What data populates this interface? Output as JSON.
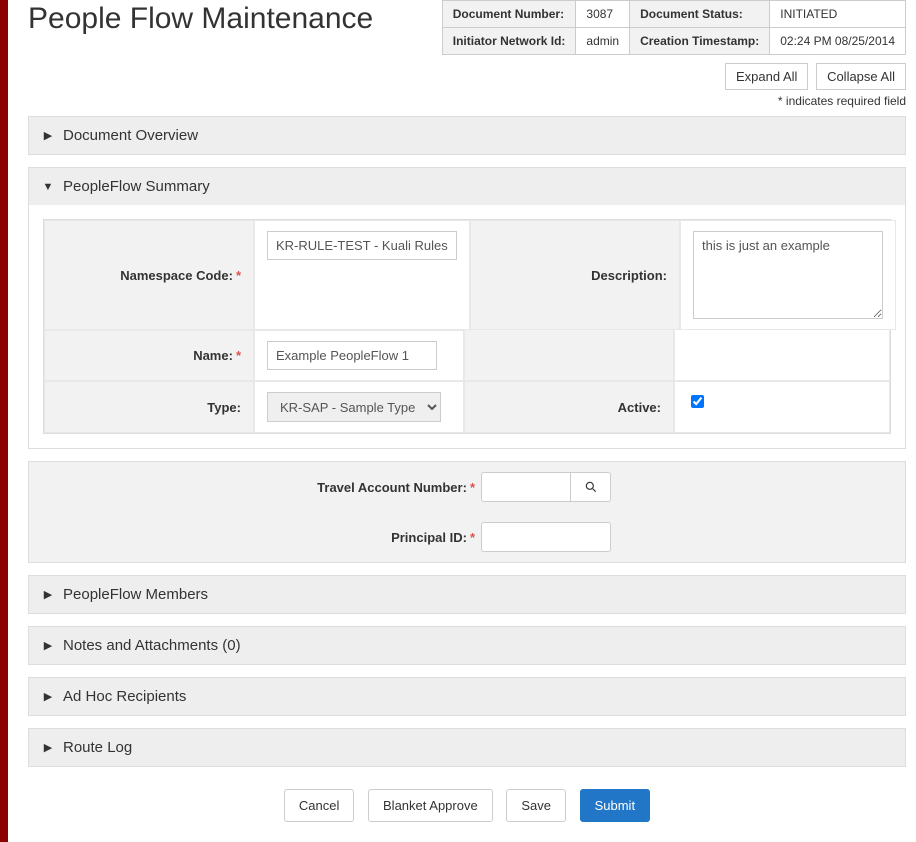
{
  "page_title": "People Flow Maintenance",
  "doc_info": {
    "number_label": "Document Number:",
    "number_value": "3087",
    "status_label": "Document Status:",
    "status_value": "INITIATED",
    "initiator_label": "Initiator Network Id:",
    "initiator_value": "admin",
    "created_label": "Creation Timestamp:",
    "created_value": "02:24 PM 08/25/2014"
  },
  "toolbar": {
    "expand_all": "Expand All",
    "collapse_all": "Collapse All"
  },
  "required_note": "* indicates required field",
  "sections": {
    "doc_overview": "Document Overview",
    "summary": "PeopleFlow Summary",
    "members": "PeopleFlow Members",
    "notes": "Notes and Attachments (0)",
    "adhoc": "Ad Hoc Recipients",
    "routelog": "Route Log"
  },
  "summary_form": {
    "namespace_label": "Namespace Code:",
    "namespace_value": "KR-RULE-TEST - Kuali Rules Test",
    "description_label": "Description:",
    "description_value": "this is just an example",
    "name_label": "Name:",
    "name_value": "Example PeopleFlow 1",
    "type_label": "Type:",
    "type_value": "KR-SAP - Sample Type",
    "active_label": "Active:"
  },
  "account_form": {
    "travel_label": "Travel Account Number:",
    "principal_label": "Principal ID:"
  },
  "actions": {
    "cancel": "Cancel",
    "blanket_approve": "Blanket Approve",
    "save": "Save",
    "submit": "Submit"
  }
}
